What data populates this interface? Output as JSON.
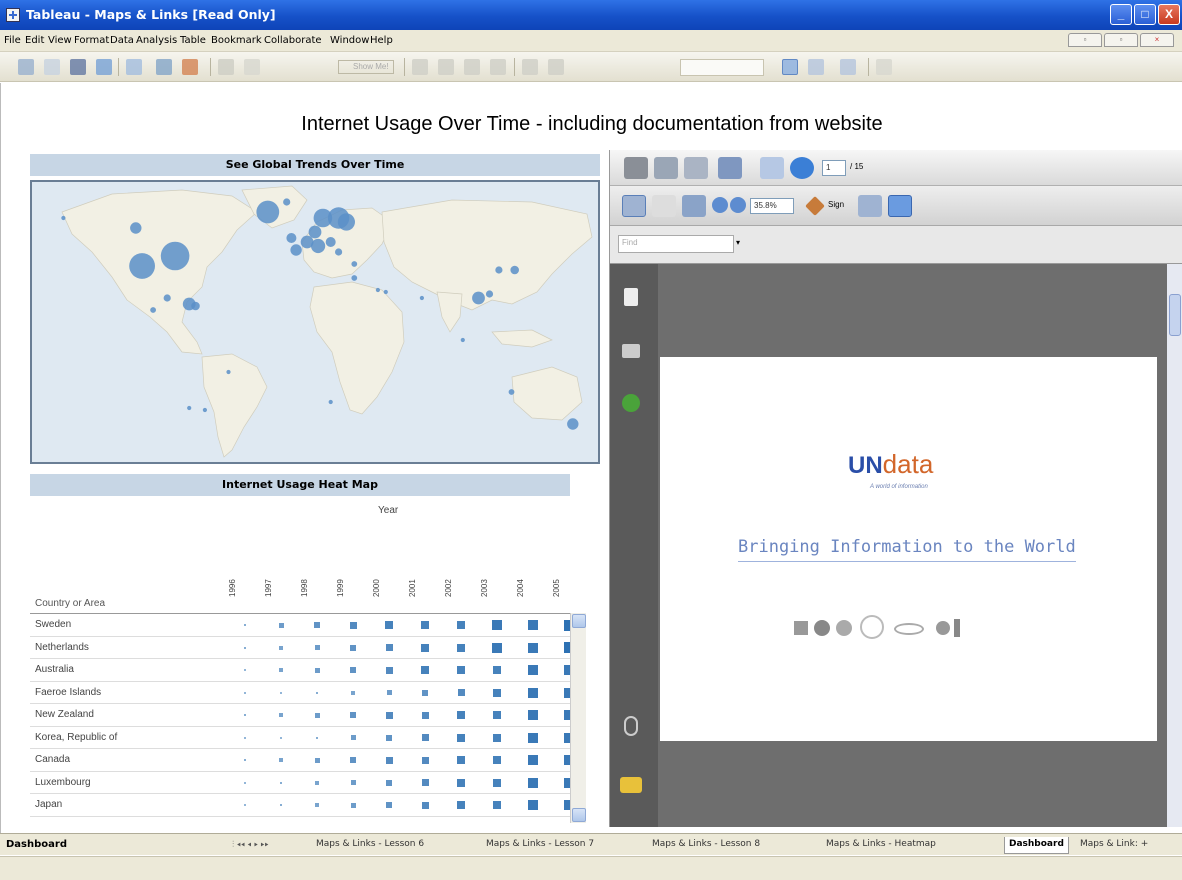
{
  "window": {
    "title": "Tableau - Maps & Links [Read Only]",
    "min": "_",
    "max": "□",
    "close": "X"
  },
  "menubar": {
    "items": [
      "File",
      "Edit",
      "View",
      "Format",
      "Data",
      "Analysis",
      "Table",
      "Bookmark",
      "Collaborate",
      "Window",
      "Help"
    ]
  },
  "toolbar": {
    "show_me": "Show Me!"
  },
  "dashboard": {
    "title": "Internet Usage Over Time - including documentation from website",
    "map_title": "See Global Trends Over Time",
    "heatmap_title": "Internet Usage Heat Map",
    "heatmap": {
      "column_header": "Year",
      "row_header": "Country or Area",
      "years": [
        "1996",
        "1997",
        "1998",
        "1999",
        "2000",
        "2001",
        "2002",
        "2003",
        "2004",
        "2005"
      ],
      "rows": [
        {
          "country": "Sweden",
          "levels": [
            2,
            4,
            5,
            6,
            7,
            7,
            7,
            8,
            8,
            9
          ]
        },
        {
          "country": "Netherlands",
          "levels": [
            2,
            3,
            4,
            5,
            6,
            7,
            7,
            8,
            8,
            9
          ]
        },
        {
          "country": "Australia",
          "levels": [
            1,
            3,
            4,
            5,
            6,
            7,
            7,
            7,
            8,
            8
          ]
        },
        {
          "country": "Faeroe Islands",
          "levels": [
            1,
            1,
            2,
            3,
            4,
            5,
            6,
            7,
            8,
            8
          ]
        },
        {
          "country": "New Zealand",
          "levels": [
            2,
            3,
            4,
            5,
            6,
            6,
            7,
            7,
            8,
            8
          ]
        },
        {
          "country": "Korea, Republic of",
          "levels": [
            1,
            1,
            2,
            4,
            5,
            6,
            7,
            7,
            8,
            8
          ]
        },
        {
          "country": "Canada",
          "levels": [
            2,
            3,
            4,
            5,
            6,
            6,
            7,
            7,
            8,
            8
          ]
        },
        {
          "country": "Luxembourg",
          "levels": [
            1,
            2,
            3,
            4,
            5,
            6,
            7,
            7,
            8,
            8
          ]
        },
        {
          "country": "Japan",
          "levels": [
            1,
            2,
            3,
            4,
            5,
            6,
            7,
            7,
            8,
            8
          ]
        }
      ]
    }
  },
  "pdf": {
    "page_current": "1",
    "page_total": "/ 15",
    "zoom": "35.8%",
    "sign_label": "Sign",
    "find_placeholder": "Find",
    "doc_logo_un": "UN",
    "doc_logo_data": "data",
    "doc_logo_tag": "A world of information",
    "doc_tagline": "Bringing Information to the World"
  },
  "tabs": {
    "current_sheet": "Dashboard",
    "items": [
      "Maps & Links - Lesson 6",
      "Maps & Links - Lesson 7",
      "Maps & Links - Lesson 8",
      "Maps & Links - Heatmap",
      "Dashboard",
      "Maps & Link: +"
    ],
    "active_index": 4
  },
  "colors": {
    "accent": "#2b6fb2",
    "map_bubble": "#5b8fc8",
    "map_land": "#f2f0e4",
    "map_water": "#dfe9f2"
  },
  "map_bubbles": [
    {
      "lon": -100,
      "lat": 38,
      "size": 18
    },
    {
      "lon": -79,
      "lat": 43,
      "size": 20
    },
    {
      "lon": -70,
      "lat": 19,
      "size": 9
    },
    {
      "lon": -66,
      "lat": 18,
      "size": 6
    },
    {
      "lon": -84,
      "lat": 22,
      "size": 5
    },
    {
      "lon": -93,
      "lat": 16,
      "size": 4
    },
    {
      "lon": -104,
      "lat": 57,
      "size": 8
    },
    {
      "lon": -20,
      "lat": 65,
      "size": 16
    },
    {
      "lon": 15,
      "lat": 62,
      "size": 13
    },
    {
      "lon": 10,
      "lat": 55,
      "size": 9
    },
    {
      "lon": 25,
      "lat": 62,
      "size": 15
    },
    {
      "lon": 30,
      "lat": 60,
      "size": 12
    },
    {
      "lon": -8,
      "lat": 70,
      "size": 5
    },
    {
      "lon": 5,
      "lat": 50,
      "size": 9
    },
    {
      "lon": 12,
      "lat": 48,
      "size": 10
    },
    {
      "lon": -2,
      "lat": 46,
      "size": 8
    },
    {
      "lon": 20,
      "lat": 50,
      "size": 7
    },
    {
      "lon": -5,
      "lat": 52,
      "size": 7
    },
    {
      "lon": 25,
      "lat": 45,
      "size": 5
    },
    {
      "lon": 35,
      "lat": 39,
      "size": 4
    },
    {
      "lon": 35,
      "lat": 32,
      "size": 4
    },
    {
      "lon": 50,
      "lat": 26,
      "size": 3
    },
    {
      "lon": 55,
      "lat": 25,
      "size": 3
    },
    {
      "lon": 127,
      "lat": 36,
      "size": 5
    },
    {
      "lon": 137,
      "lat": 36,
      "size": 6
    },
    {
      "lon": 114,
      "lat": 22,
      "size": 9
    },
    {
      "lon": 121,
      "lat": 24,
      "size": 5
    },
    {
      "lon": 104,
      "lat": 1,
      "size": 3
    },
    {
      "lon": 135,
      "lat": -25,
      "size": 4
    },
    {
      "lon": 174,
      "lat": -41,
      "size": 8
    },
    {
      "lon": -150,
      "lat": 62,
      "size": 3
    },
    {
      "lon": -45,
      "lat": -15,
      "size": 3
    },
    {
      "lon": -70,
      "lat": -33,
      "size": 3
    },
    {
      "lon": -60,
      "lat": -34,
      "size": 3
    },
    {
      "lon": 20,
      "lat": -30,
      "size": 3
    },
    {
      "lon": 78,
      "lat": 22,
      "size": 3
    }
  ]
}
